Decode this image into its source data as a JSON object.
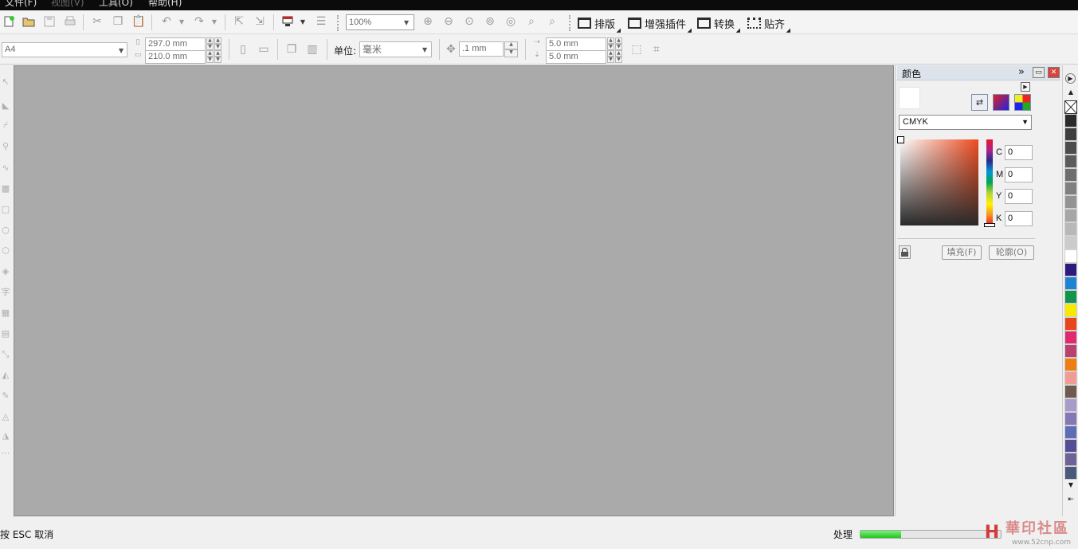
{
  "menu": {
    "items": [
      {
        "label": "文件(F)",
        "enabled": true
      },
      {
        "label": "视图(V)",
        "enabled": false
      },
      {
        "label": "工具(O)",
        "enabled": true
      },
      {
        "label": "帮助(H)",
        "enabled": true
      }
    ]
  },
  "toolbar": {
    "zoom_value": "100%",
    "plugins": [
      {
        "label": "排版",
        "icon": "layout-icon"
      },
      {
        "label": "增强插件",
        "icon": "plugin-icon"
      },
      {
        "label": "转换",
        "icon": "convert-icon"
      },
      {
        "label": "贴齐",
        "icon": "snap-icon"
      }
    ]
  },
  "property_bar": {
    "page_size": "A4",
    "width": "297.0 mm",
    "height": "210.0 mm",
    "unit_label": "单位:",
    "unit_value": "毫米",
    "nudge": ".1 mm",
    "dup_x": "5.0 mm",
    "dup_y": "5.0 mm"
  },
  "color_panel": {
    "title": "颜色",
    "model": "CMYK",
    "channels": [
      {
        "label": "C",
        "value": "0"
      },
      {
        "label": "M",
        "value": "0"
      },
      {
        "label": "Y",
        "value": "0"
      },
      {
        "label": "K",
        "value": "0"
      }
    ],
    "fill_label": "填充(F)",
    "outline_label": "轮廓(O)",
    "current_color": "#ffffff"
  },
  "palette": {
    "colors": [
      "#2b2b2b",
      "#3e3e3e",
      "#4d4d4d",
      "#5c5c5c",
      "#6e6e6e",
      "#808080",
      "#939393",
      "#a6a6a6",
      "#b8b8b8",
      "#cbcbcb",
      "#ffffff",
      "#2e1a7c",
      "#1f83d4",
      "#12954a",
      "#f8e900",
      "#e8461a",
      "#e12a6e",
      "#b8416e",
      "#ee7d13",
      "#f19d96",
      "#6e5a4e",
      "#a89bc9",
      "#8477b5",
      "#5e6db7",
      "#554e96",
      "#6f6297",
      "#4a5a7a"
    ]
  },
  "status": {
    "hint": "按 ESC 取消",
    "processing_label": "处理",
    "progress": 0.29
  },
  "watermark": {
    "logo": "H",
    "text": "華印社區",
    "url": "www.52cnp.com"
  }
}
